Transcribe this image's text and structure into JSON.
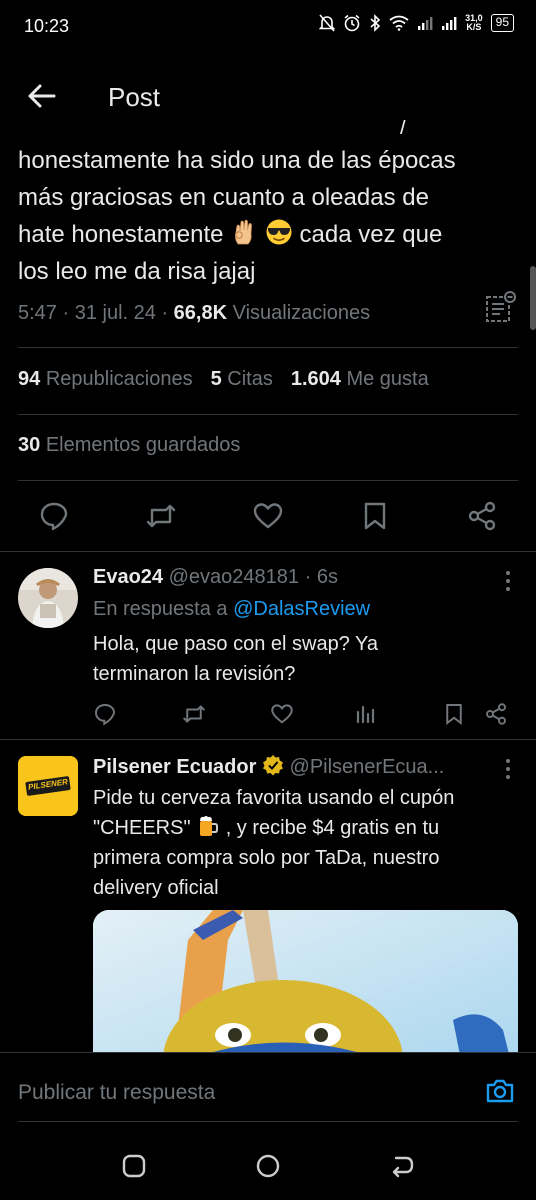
{
  "status_bar": {
    "time": "10:23",
    "net_speed_value": "31,0",
    "net_speed_unit": "K/S",
    "battery": "95"
  },
  "header": {
    "title": "Post"
  },
  "tweet": {
    "partial_line": "/",
    "text_line1": "honestamente ha sido una de las épocas",
    "text_line2": "más graciosas en cuanto a oleadas de",
    "text_line3a": "hate honestamente",
    "text_line3b": "cada vez que",
    "text_line4": "los leo me da risa jajaj",
    "emoji1": "ok-hand-emoji",
    "emoji2": "sunglasses-emoji",
    "time": "5:47",
    "date": "31 jul. 24",
    "views_count": "66,8K",
    "views_label": "Visualizaciones",
    "reposts_count": "94",
    "reposts_label": "Republicaciones",
    "quotes_count": "5",
    "quotes_label": "Citas",
    "likes_count": "1.604",
    "likes_label": "Me gusta",
    "bookmarks_count": "30",
    "bookmarks_label": "Elementos guardados"
  },
  "replies": [
    {
      "name": "Evao24",
      "handle": "@evao248181",
      "time": "6s",
      "reply_to_label": "En respuesta a",
      "reply_to_handle": "@DalasReview",
      "line1": "Hola, que paso con el swap? Ya",
      "line2": "terminaron la revisión?"
    },
    {
      "name": "Pilsener Ecuador",
      "handle": "@PilsenerEcua...",
      "logo_text": "PILSENER",
      "line1": "Pide tu cerveza favorita usando el cupón",
      "line2a": "\"CHEERS\"",
      "line2b": ", y recibe  $4 gratis en tu",
      "line3": "primera compra solo por TaDa, nuestro",
      "line4": "delivery oficial",
      "emoji": "beer-mug-emoji"
    }
  ],
  "compose": {
    "placeholder": "Publicar tu respuesta"
  },
  "colors": {
    "background": "#000000",
    "text": "#e7e9ea",
    "muted": "#71767b",
    "link": "#1d9bf0",
    "divider": "#2f3336",
    "verified": "#e2b719"
  }
}
